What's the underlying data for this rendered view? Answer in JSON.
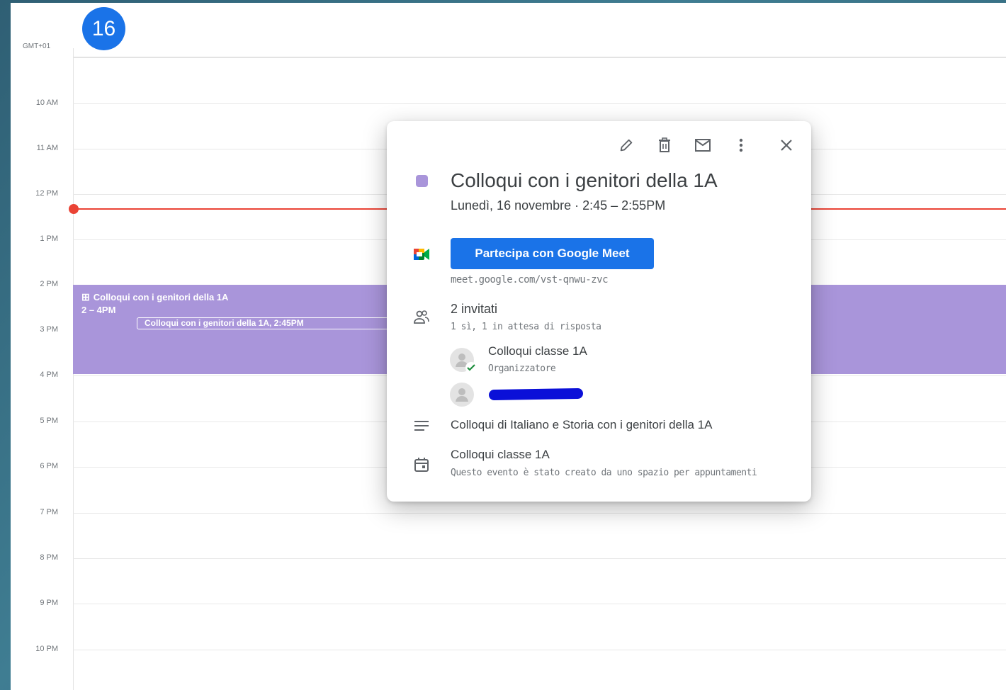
{
  "calendar": {
    "day_number": "16",
    "timezone": "GMT+01",
    "hours": [
      "10 AM",
      "11 AM",
      "12 PM",
      "1 PM",
      "2 PM",
      "3 PM",
      "4 PM",
      "5 PM",
      "6 PM",
      "7 PM",
      "8 PM",
      "9 PM",
      "10 PM"
    ],
    "event": {
      "title": "Colloqui con i genitori della 1A",
      "time": "2 – 4PM",
      "sub_event": "Colloqui con i genitori della 1A, 2:45PM"
    },
    "colors": {
      "accent": "#1a73e8",
      "event": "#a995da",
      "now_line": "#ea4335"
    }
  },
  "popup": {
    "toolbar": {
      "edit_icon": "pencil-icon",
      "delete_icon": "trash-icon",
      "email_icon": "mail-icon",
      "more_icon": "more-vert-icon",
      "close_icon": "close-icon"
    },
    "title": "Colloqui con i genitori della 1A",
    "date_line": "Lunedì, 16 novembre  ·  2:45 – 2:55PM",
    "meet": {
      "button_label": "Partecipa con Google Meet",
      "link": "meet.google.com/vst-qnwu-zvc",
      "icon": "google-meet-icon"
    },
    "guests": {
      "summary": "2 invitati",
      "response": "1 sì, 1 in attesa di risposta",
      "list": [
        {
          "name": "Colloqui classe 1A",
          "role": "Organizzatore"
        }
      ]
    },
    "description": "Colloqui  di Italiano e Storia con i genitori della 1A",
    "calendar_info": {
      "name": "Colloqui classe 1A",
      "note": "Questo evento è stato creato da uno spazio per appuntamenti"
    }
  }
}
